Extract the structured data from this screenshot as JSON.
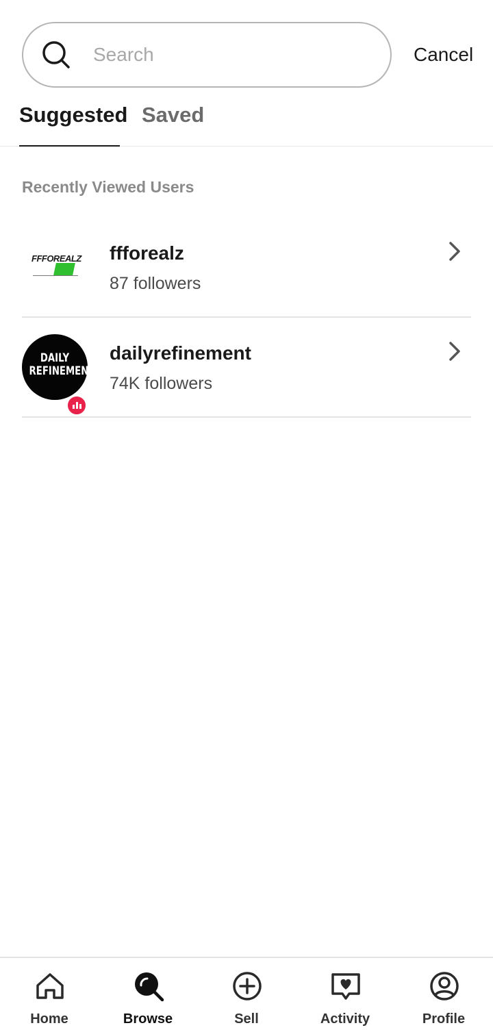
{
  "search": {
    "placeholder": "Search",
    "value": "",
    "cancel_label": "Cancel"
  },
  "tabs": [
    {
      "label": "Suggested",
      "active": true
    },
    {
      "label": "Saved",
      "active": false
    }
  ],
  "section": {
    "title": "Recently Viewed Users"
  },
  "users": [
    {
      "name": "ffforealz",
      "followers": "87 followers",
      "avatar_text": "FFFOREALZ",
      "avatar_icon": "ffforealz-logo-icon"
    },
    {
      "name": "dailyrefinement",
      "followers": "74K followers",
      "avatar_text_1": "DAILY",
      "avatar_text_2": "REFINEMENT",
      "badge_icon": "bar-chart-badge-icon"
    }
  ],
  "nav": [
    {
      "label": "Home",
      "icon": "home-icon"
    },
    {
      "label": "Browse",
      "icon": "browse-icon",
      "active": true
    },
    {
      "label": "Sell",
      "icon": "plus-circle-icon"
    },
    {
      "label": "Activity",
      "icon": "heart-chat-icon"
    },
    {
      "label": "Profile",
      "icon": "profile-icon"
    }
  ],
  "colors": {
    "accent": "#e8224a",
    "text": "#1a1a1a",
    "muted": "#8a8a8a",
    "border": "#e4e4e4"
  }
}
